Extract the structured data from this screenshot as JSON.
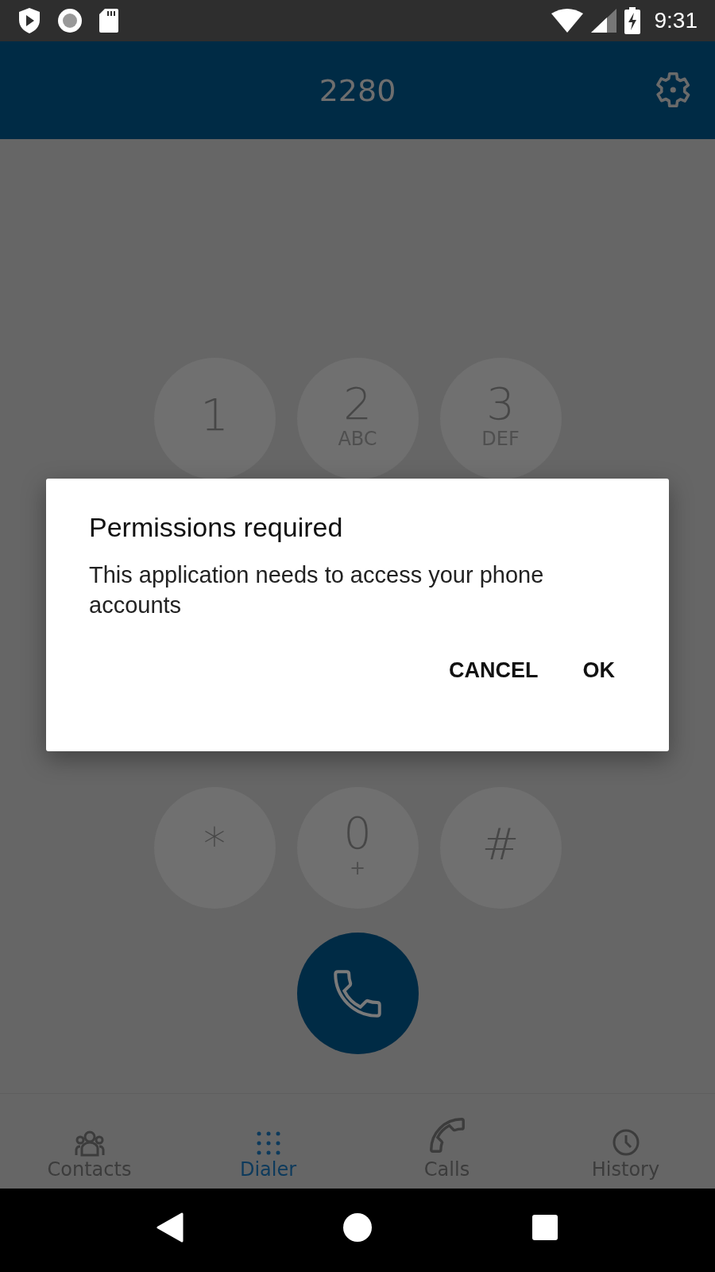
{
  "status_bar": {
    "time": "9:31"
  },
  "header": {
    "number": "2280"
  },
  "keypad": {
    "rows": [
      [
        {
          "digit": "1"
        },
        {
          "digit": "2",
          "letters": "ABC"
        },
        {
          "digit": "3",
          "letters": "DEF"
        }
      ],
      [
        {
          "digit": "*"
        },
        {
          "digit": "0",
          "letters": "+"
        },
        {
          "digit": "#"
        }
      ]
    ]
  },
  "dialog": {
    "title": "Permissions required",
    "message": "This application needs to access your phone accounts",
    "buttons": [
      "CANCEL",
      "OK"
    ]
  },
  "bottom_nav": [
    {
      "kind": "contacts",
      "label": "Contacts",
      "selected": false
    },
    {
      "kind": "dialer",
      "label": "Dialer",
      "selected": true
    },
    {
      "kind": "calls",
      "label": "Calls",
      "selected": false
    },
    {
      "kind": "history",
      "label": "History",
      "selected": false
    }
  ]
}
